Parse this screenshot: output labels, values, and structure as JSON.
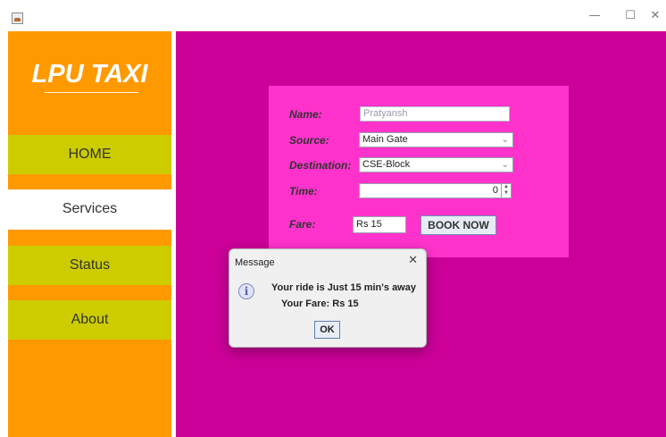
{
  "window": {
    "minimize": "—",
    "maximize": "☐",
    "close": "✕"
  },
  "sidebar": {
    "logo": "LPU TAXI",
    "items": [
      {
        "label": "HOME"
      },
      {
        "label": "Services"
      },
      {
        "label": "Status"
      },
      {
        "label": "About"
      }
    ],
    "selected": "Services"
  },
  "form": {
    "name_label": "Name:",
    "name_value": "Pratyansh",
    "source_label": "Source:",
    "source_value": "Main Gate",
    "destination_label": "Destination:",
    "destination_value": "CSE-Block",
    "time_label": "Time:",
    "time_value": "0",
    "fare_label": "Fare:",
    "fare_value": "Rs 15",
    "book_button": "BOOK NOW"
  },
  "dialog": {
    "title": "Message",
    "close": "✕",
    "icon": "info-icon",
    "line1": "Your ride is Just 15 min's away",
    "line2": "Your Fare: Rs 15",
    "ok_button": "OK"
  },
  "colors": {
    "sidebar": "#ff9900",
    "nav_highlight": "#cccc00",
    "nav_selected": "#ffffff",
    "main_bg": "#cc0099",
    "form_panel": "#ff33cc"
  },
  "icons": {
    "app": "java-app-icon",
    "dropdown": "chevron-down-icon"
  }
}
